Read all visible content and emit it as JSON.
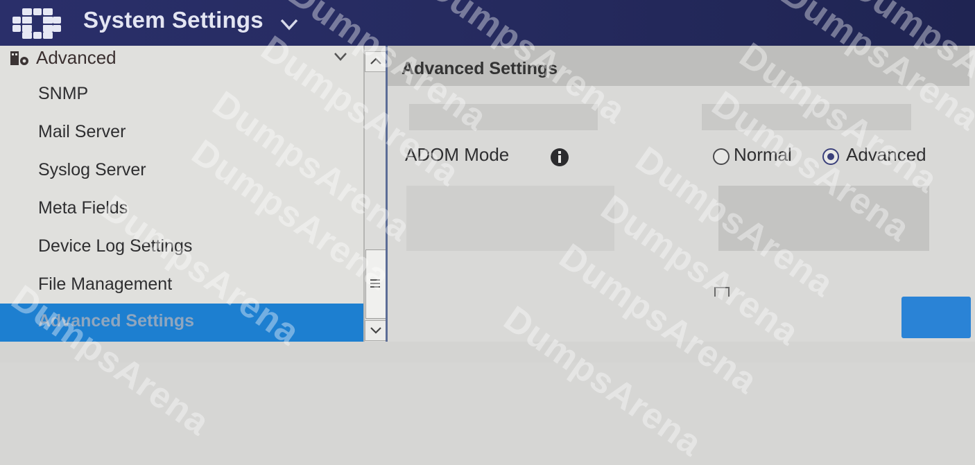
{
  "header": {
    "title": "System Settings",
    "logo_icon": "fortinet-grid-logo-icon",
    "dropdown_icon": "chevron-down-icon"
  },
  "sidebar": {
    "group": {
      "label": "Advanced",
      "icon": "folder-gear-icon",
      "chevron": "chevron-down-icon"
    },
    "items": [
      {
        "label": "SNMP"
      },
      {
        "label": "Mail Server"
      },
      {
        "label": "Syslog Server"
      },
      {
        "label": "Meta Fields"
      },
      {
        "label": "Device Log Settings"
      },
      {
        "label": "File Management"
      },
      {
        "label": "Advanced Settings",
        "active": true
      }
    ]
  },
  "main": {
    "title": "Advanced Settings",
    "adom_mode": {
      "label": "ADOM Mode",
      "info_icon": "info-icon",
      "options": [
        {
          "label": "Normal",
          "selected": false
        },
        {
          "label": "Advanced",
          "selected": true
        }
      ]
    }
  },
  "colors": {
    "header_bg": "#2a2f6a",
    "active_item_bg": "#1d7fd0",
    "apply_button": "#2a83d6"
  },
  "watermark": "DumpsArena"
}
